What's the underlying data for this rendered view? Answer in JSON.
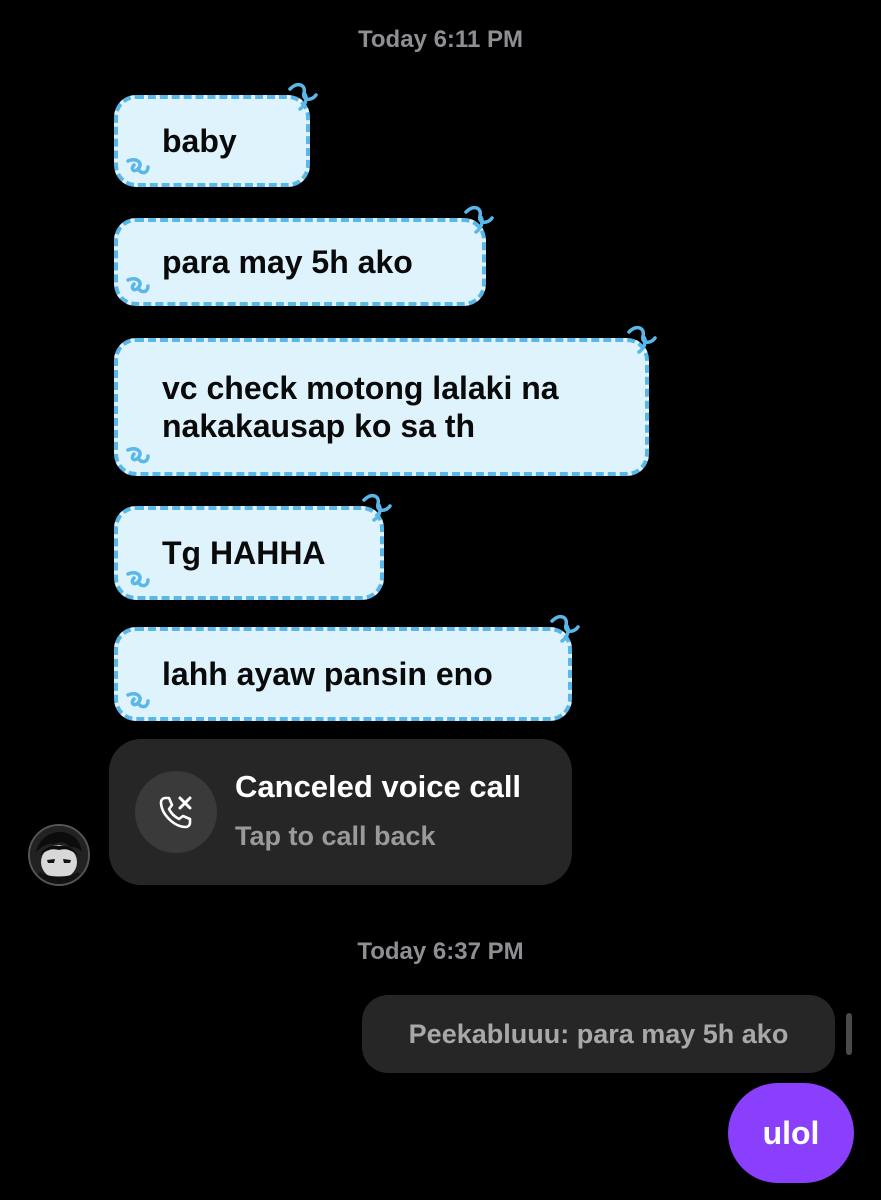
{
  "timestamps": {
    "first": "Today 6:11 PM",
    "second": "Today 6:37 PM"
  },
  "incoming_messages": [
    {
      "text": "baby"
    },
    {
      "text": "para may 5h ako"
    },
    {
      "text": "vc check motong lalaki na\nnakakausap ko sa th"
    },
    {
      "text": "Tg HAHHA"
    },
    {
      "text": "lahh ayaw pansin eno"
    }
  ],
  "call": {
    "title": "Canceled voice call",
    "subtitle": "Tap to call back",
    "icon": "missed-call-phone-icon"
  },
  "reply": {
    "text": "Peekabluuu: para may 5h ako"
  },
  "sent_message": {
    "text": "ulol"
  },
  "colors": {
    "background": "#000000",
    "incoming_bubble": "#dff3fd",
    "incoming_border": "#5ab8e8",
    "sent_bubble": "#8a3ffc",
    "card": "#262626",
    "muted_text": "#8e8e93"
  }
}
